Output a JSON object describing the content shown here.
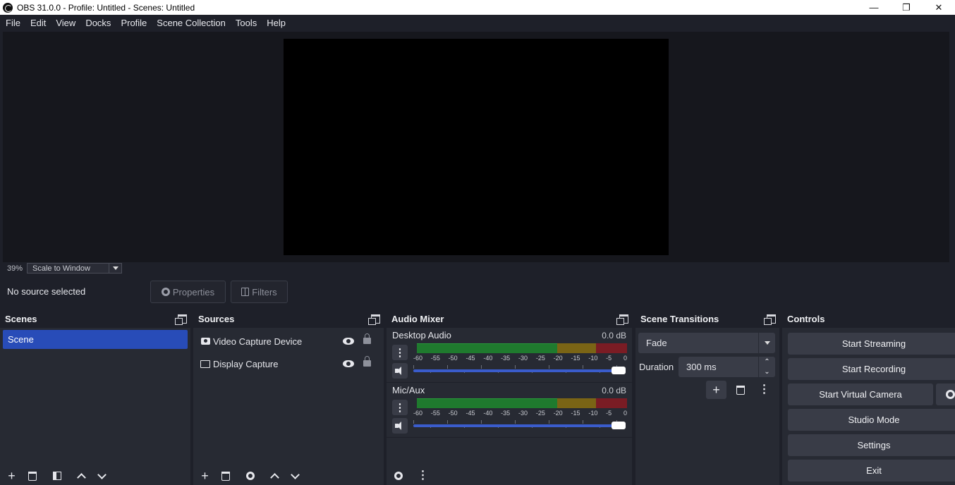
{
  "window": {
    "title": "OBS 31.0.0 - Profile: Untitled - Scenes: Untitled"
  },
  "menu": [
    "File",
    "Edit",
    "View",
    "Docks",
    "Profile",
    "Scene Collection",
    "Tools",
    "Help"
  ],
  "preview": {
    "zoom": "39%",
    "scale_mode": "Scale to Window"
  },
  "source_toolbar": {
    "status": "No source selected",
    "properties_label": "Properties",
    "filters_label": "Filters"
  },
  "scenes": {
    "title": "Scenes",
    "items": [
      "Scene"
    ]
  },
  "sources": {
    "title": "Sources",
    "items": [
      "Video Capture Device",
      "Display Capture"
    ]
  },
  "mixer": {
    "title": "Audio Mixer",
    "channels": [
      {
        "name": "Desktop Audio",
        "level": "0.0 dB"
      },
      {
        "name": "Mic/Aux",
        "level": "0.0 dB"
      }
    ],
    "scale_labels": [
      "-60",
      "-55",
      "-50",
      "-45",
      "-40",
      "-35",
      "-30",
      "-25",
      "-20",
      "-15",
      "-10",
      "-5",
      "0"
    ]
  },
  "transitions": {
    "title": "Scene Transitions",
    "selected": "Fade",
    "duration_label": "Duration",
    "duration_value": "300 ms"
  },
  "controls": {
    "title": "Controls",
    "start_streaming": "Start Streaming",
    "start_recording": "Start Recording",
    "start_virtual_camera": "Start Virtual Camera",
    "studio_mode": "Studio Mode",
    "settings": "Settings",
    "exit": "Exit"
  }
}
